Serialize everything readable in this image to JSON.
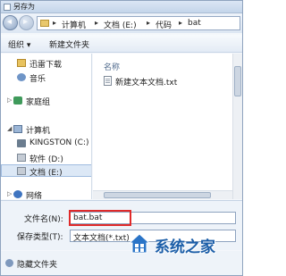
{
  "window": {
    "title": "另存为"
  },
  "address": {
    "crumbs": [
      "计算机",
      "文档 (E:)",
      "代码",
      "bat"
    ],
    "separator": "▸"
  },
  "toolbar": {
    "organize": "组织 ▾",
    "new_folder": "新建文件夹"
  },
  "nav": {
    "items": [
      {
        "label": "迅雷下载",
        "icon": "folder-icon"
      },
      {
        "label": "音乐",
        "icon": "music-icon"
      },
      {
        "label": "家庭组",
        "icon": "homegroup-icon"
      },
      {
        "label": "计算机",
        "icon": "computer-icon"
      },
      {
        "label": "KINGSTON (C:)",
        "icon": "usb-drive-icon"
      },
      {
        "label": "软件 (D:)",
        "icon": "drive-icon"
      },
      {
        "label": "文档 (E:)",
        "icon": "drive-icon",
        "selected": true
      },
      {
        "label": "网络",
        "icon": "network-icon"
      }
    ]
  },
  "files": {
    "column_name": "名称",
    "items": [
      {
        "name": "新建文本文档.txt"
      }
    ]
  },
  "form": {
    "filename_label": "文件名(N):",
    "filename_value": "bat.bat",
    "type_label": "保存类型(T):",
    "type_value": "文本文档(*.txt)"
  },
  "footer": {
    "hide_folders": "隐藏文件夹"
  },
  "watermark": {
    "text": "系统之家"
  },
  "colors": {
    "highlight": "#e02a2a",
    "watermark": "#1c5ea8"
  }
}
